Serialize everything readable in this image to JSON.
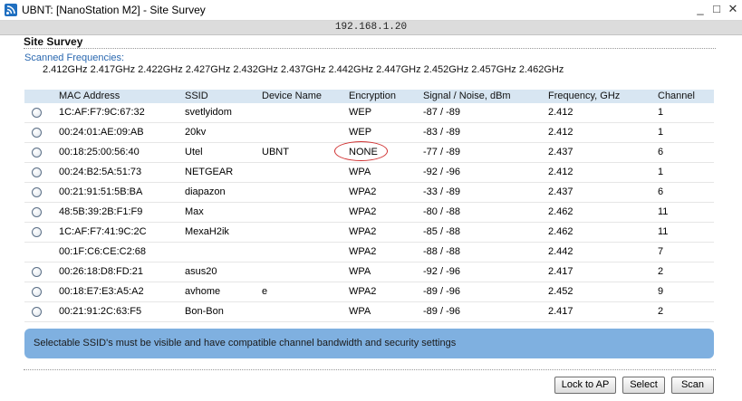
{
  "window": {
    "title": "UBNT: [NanoStation M2] - Site Survey",
    "minimize_glyph": "_",
    "maximize_glyph": "□",
    "close_glyph": "✕"
  },
  "address": "192.168.1.20",
  "page": {
    "heading": "Site Survey",
    "scanned_label": "Scanned Frequencies:",
    "frequencies": "2.412GHz 2.417GHz 2.422GHz 2.427GHz 2.432GHz 2.437GHz 2.442GHz 2.447GHz 2.452GHz 2.457GHz 2.462GHz"
  },
  "table": {
    "headers": {
      "mac": "MAC Address",
      "ssid": "SSID",
      "device": "Device Name",
      "encryption": "Encryption",
      "signal": "Signal / Noise, dBm",
      "frequency": "Frequency, GHz",
      "channel": "Channel"
    },
    "rows": [
      {
        "selectable": true,
        "mac": "1C:AF:F7:9C:67:32",
        "ssid": "svetlyidom",
        "device": "",
        "encryption": "WEP",
        "signal": "-87 / -89",
        "frequency": "2.412",
        "channel": "1"
      },
      {
        "selectable": true,
        "mac": "00:24:01:AE:09:AB",
        "ssid": "20kv",
        "device": "",
        "encryption": "WEP",
        "signal": "-83 / -89",
        "frequency": "2.412",
        "channel": "1"
      },
      {
        "selectable": true,
        "mac": "00:18:25:00:56:40",
        "ssid": "Utel",
        "device": "UBNT",
        "encryption": "NONE",
        "signal": "-77 / -89",
        "frequency": "2.437",
        "channel": "6"
      },
      {
        "selectable": true,
        "mac": "00:24:B2:5A:51:73",
        "ssid": "NETGEAR",
        "device": "",
        "encryption": "WPA",
        "signal": "-92 / -96",
        "frequency": "2.412",
        "channel": "1"
      },
      {
        "selectable": true,
        "mac": "00:21:91:51:5B:BA",
        "ssid": "diapazon",
        "device": "",
        "encryption": "WPA2",
        "signal": "-33 / -89",
        "frequency": "2.437",
        "channel": "6"
      },
      {
        "selectable": true,
        "mac": "48:5B:39:2B:F1:F9",
        "ssid": "Max",
        "device": "",
        "encryption": "WPA2",
        "signal": "-80 / -88",
        "frequency": "2.462",
        "channel": "11"
      },
      {
        "selectable": true,
        "mac": "1C:AF:F7:41:9C:2C",
        "ssid": "MexaH2ik",
        "device": "",
        "encryption": "WPA2",
        "signal": "-85 / -88",
        "frequency": "2.462",
        "channel": "11"
      },
      {
        "selectable": false,
        "mac": "00:1F:C6:CE:C2:68",
        "ssid": "",
        "device": "",
        "encryption": "WPA2",
        "signal": "-88 / -88",
        "frequency": "2.442",
        "channel": "7"
      },
      {
        "selectable": true,
        "mac": "00:26:18:D8:FD:21",
        "ssid": "asus20",
        "device": "",
        "encryption": "WPA",
        "signal": "-92 / -96",
        "frequency": "2.417",
        "channel": "2"
      },
      {
        "selectable": true,
        "mac": "00:18:E7:E3:A5:A2",
        "ssid": "avhome",
        "device": "e",
        "encryption": "WPA2",
        "signal": "-89 / -96",
        "frequency": "2.452",
        "channel": "9"
      },
      {
        "selectable": true,
        "mac": "00:21:91:2C:63:F5",
        "ssid": "Bon-Bon",
        "device": "",
        "encryption": "WPA",
        "signal": "-89 / -96",
        "frequency": "2.417",
        "channel": "2"
      }
    ]
  },
  "info": "Selectable SSID's must be visible and have compatible channel bandwidth and security settings",
  "buttons": {
    "lock": "Lock to AP",
    "select": "Select",
    "scan": "Scan"
  },
  "colors": {
    "header_bg": "#d8e6f2",
    "info_bg": "#7fb0e0",
    "link_blue": "#2a68b0",
    "annotation_red": "#d03030"
  }
}
